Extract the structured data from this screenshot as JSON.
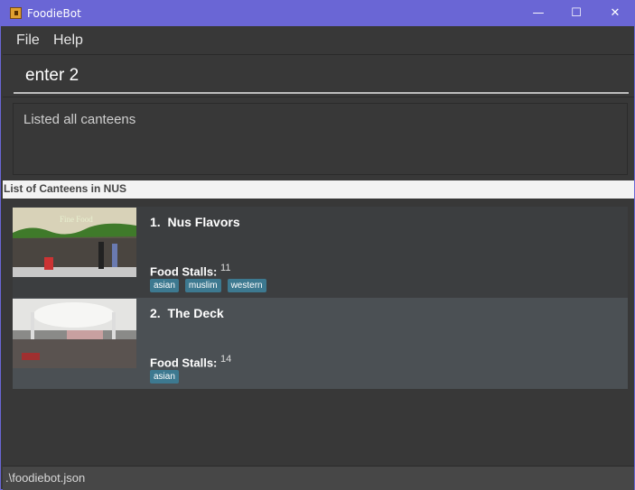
{
  "window": {
    "title": "FoodieBot",
    "minimize": "—",
    "maximize": "☐",
    "close": "✕"
  },
  "menu": {
    "items": [
      "File",
      "Help"
    ]
  },
  "command": {
    "value": "enter 2"
  },
  "result": {
    "text": "Listed all canteens"
  },
  "list": {
    "header": "List of Canteens in NUS",
    "stalls_label": "Food Stalls:",
    "canteens": [
      {
        "index": "1.",
        "name": "Nus Flavors",
        "stalls": "11",
        "tags": [
          "asian",
          "muslim",
          "western"
        ],
        "photo_caption": "Fine Food"
      },
      {
        "index": "2.",
        "name": "The Deck",
        "stalls": "14",
        "tags": [
          "asian"
        ]
      }
    ]
  },
  "colors": {
    "titlebar": "#6a66d5",
    "tag": "#3d7990",
    "card_odd": "#3c3e40",
    "card_even": "#4b5054"
  },
  "status": {
    "path": ".\\foodiebot.json"
  }
}
